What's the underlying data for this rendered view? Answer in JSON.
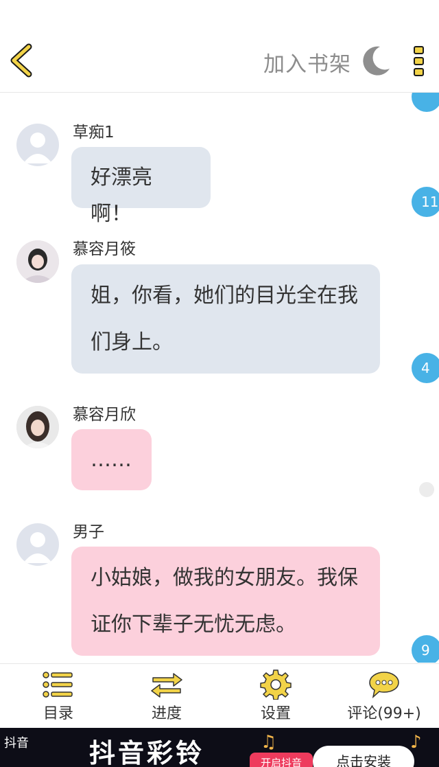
{
  "header": {
    "add_shelf_label": "加入书架",
    "icons": [
      "back-chevron-icon",
      "moon-icon",
      "more-dots-icon"
    ]
  },
  "messages": [
    {
      "name": "草痴1",
      "text": "好漂亮啊！",
      "badge": "11",
      "style": "blue",
      "avatar": "default"
    },
    {
      "name": "慕容月筱",
      "text": "姐，你看，她们的目光全在我们身上。",
      "badge": "4",
      "style": "blue",
      "avatar": "photo"
    },
    {
      "name": "慕容月欣",
      "text": "……",
      "badge": "",
      "style": "pink",
      "avatar": "photo"
    },
    {
      "name": "男子",
      "text": "小姑娘，做我的女朋友。我保证你下辈子无忧无虑。",
      "badge": "9",
      "style": "pink",
      "avatar": "default"
    }
  ],
  "bottom_nav": [
    {
      "label": "目录",
      "icon": "list-icon"
    },
    {
      "label": "进度",
      "icon": "swap-arrows-icon"
    },
    {
      "label": "设置",
      "icon": "gear-icon"
    },
    {
      "label": "评论(99+)",
      "icon": "comment-bubble-icon"
    }
  ],
  "ad": {
    "brand": "抖音",
    "title": "抖音彩铃",
    "open_label": "开启抖音",
    "install_label": "点击安装"
  },
  "colors": {
    "accent_yellow": "#f2d348",
    "bubble_blue": "#e0e6ee",
    "bubble_pink": "#fcd0dc",
    "badge_blue": "#48b2e6"
  }
}
